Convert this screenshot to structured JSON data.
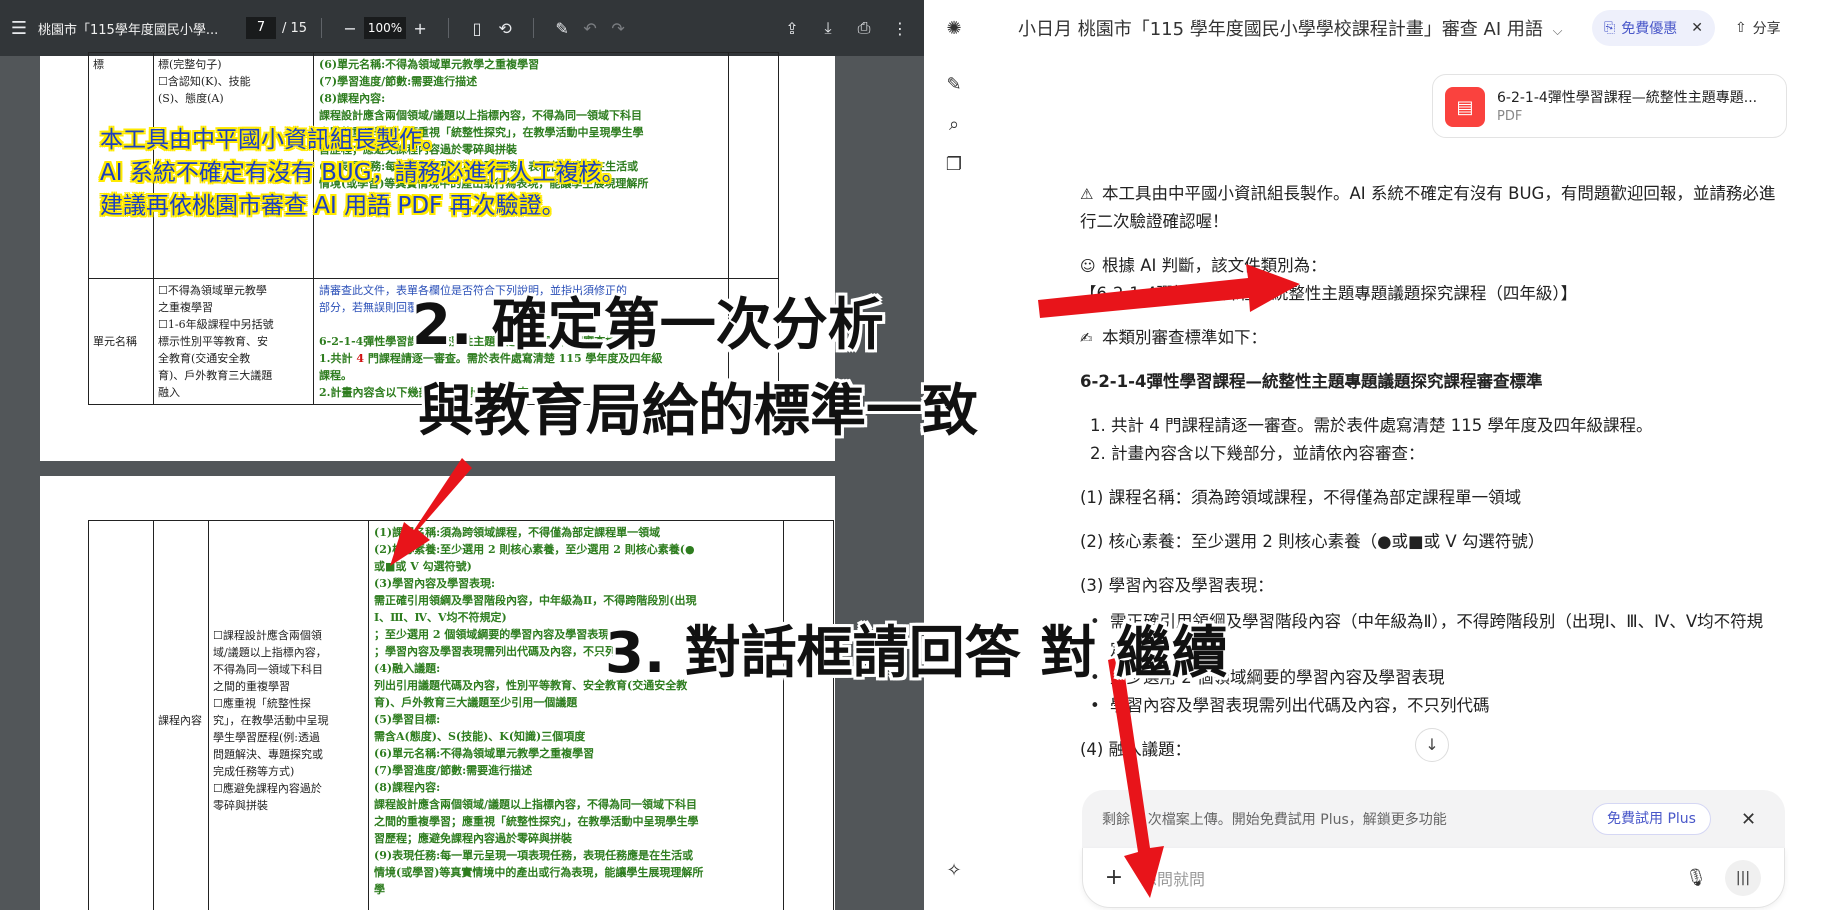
{
  "pdf": {
    "title": "桃園市「115學年度國民小學...",
    "page_current": "7",
    "page_total": "/ 15",
    "zoom": "100%",
    "page_a": {
      "col1": "標",
      "col2_lines": [
        "標(完整句子)",
        "☐含認知(K)、技能",
        "(S)、態度(A)"
      ],
      "col3_lines": [
        {
          "t": "(6)單元名稱:不得為領域單元教學之重複學習",
          "c": "grn"
        },
        {
          "t": "(7)學習進度/節數:需要進行描述",
          "c": "grn"
        },
        {
          "t": "(8)課程內容:",
          "c": "grn"
        },
        {
          "t": "課程設計應含兩個領域/議題以上指標內容，不得為同一領域下科目",
          "c": "grn"
        },
        {
          "t": "之間的重複學習；應重視「統整性探究」，在教學活動中呈現學生學",
          "c": "grn"
        },
        {
          "t": "習歷程；應避免課程內容過於零碎與拼裝",
          "c": "grn"
        },
        {
          "t": "(9)表現任務:每一單元呈現一項表現任務，表現任務應是在生活或",
          "c": "grn"
        },
        {
          "t": "情境(或學習)等真實情境中的產出或行為表現，能讓學生展現理解所",
          "c": "grn"
        }
      ],
      "row2_col1": "單元名稱",
      "row2_col2_lines": [
        "☐不得為領域單元教學",
        "之重複學習",
        "☐1-6年級課程中另括號",
        "標示性別平等教育、安",
        "全教育(交通安全教",
        "育)、戶外教育三大議題",
        "融入"
      ],
      "row2_col3_lines": [
        {
          "t": "請審查此文件，表單各欄位是否符合下列說明，並指出須修正的",
          "c": "blu"
        },
        {
          "t": "部分，若無誤則回覆無誤",
          "c": "blu"
        },
        {
          "t": "",
          "c": ""
        },
        {
          "t": "6-2-1-4彈性學習課程—統整性主題專題議題探究課程審查標準",
          "c": "grn"
        },
        {
          "t": "1.共計 4 門課程請逐一審查。需於表件處寫清楚 115 學年度及四年級",
          "c": "grn",
          "red": "4"
        },
        {
          "t": "課程。",
          "c": "grn"
        },
        {
          "t": "2.計畫內容含以下幾部分，並請依內容審查:",
          "c": "grn"
        }
      ]
    },
    "page_b": {
      "col1": "課程內容",
      "col2_lines": [
        "☐課程設計應含兩個領",
        "域/議題以上指標內容，",
        "不得為同一領域下科目",
        "之間的重複學習",
        "☐應重視「統整性探",
        "究」，在教學活動中呈現",
        "學生學習歷程(例:透過",
        "問題解決、專題探究或",
        "完成任務等方式)",
        "☐應避免課程內容過於",
        "零碎與拼裝"
      ],
      "col3_lines": [
        "(1)課程名稱:須為跨領域課程，不得僅為部定課程單一領域",
        "(2)核心素養:至少選用 2 則核心素養，至少選用 2 則核心素養(●",
        "或■或 V 勾選符號)",
        "(3)學習內容及學習表現:",
        "需正確引用領綱及學習階段內容，中年級為Ⅱ，不得跨階段別(出現",
        "Ⅰ、Ⅲ、Ⅳ、V均不符規定)",
        "；至少選用 2 個領域綱要的學習內容及學習表現",
        "；學習內容及學習表現需列出代碼及內容，不只列代碼",
        "(4)融入議題:",
        "列出引用議題代碼及內容，性別平等教育、安全教育(交通安全教",
        "育)、戶外教育三大議題至少引用一個議題",
        "(5)學習目標:",
        "需含A(態度)、S(技能)、K(知識)三個項度",
        "(6)單元名稱:不得為領域單元教學之重複學習",
        "(7)學習進度/節數:需要進行描述",
        "(8)課程內容:",
        "課程設計應含兩個領域/議題以上指標內容，不得為同一領域下科目",
        "之間的重複學習；應重視「統整性探究」，在教學活動中呈現學生學",
        "習歷程；應避免課程內容過於零碎與拼裝",
        "(9)表現任務:每一單元呈現一項表現任務，表現任務應是在生活或",
        "情境(或學習)等真實情境中的產出或行為表現，能讓學生展現理解所",
        "學"
      ]
    },
    "yellow_note": [
      "本工具由中平國小資訊組長製作。",
      "AI 系統不確定有沒有 BUG，請務必進行人工複核。",
      "建議再依桃園市審查 AI 用語 PDF 再次驗證。"
    ]
  },
  "chat": {
    "title": "小日月 桃園市「115 學年度國民小學學校課程計畫」審查 AI 用語",
    "free_offer": "免費優惠",
    "share": "分享",
    "file": {
      "name": "6-2-1-4彈性學習課程—統整性主題專題...",
      "type": "PDF"
    },
    "messages": {
      "warn": "本工具由中平國小資訊組長製作。AI 系統不確定有沒有 BUG，有問題歡迎回報，並請務必進行二次驗證確認喔！",
      "judge": "根據 AI 判斷，該文件類別為：",
      "category": "【6-2-1-4彈性學習課程—統整性主題專題議題探究課程（四年級）】",
      "criteria_intro": "本類別審查標準如下：",
      "heading": "6-2-1-4彈性學習課程—統整性主題專題議題探究課程審查標準",
      "item1": "1.  共計 4 門課程請逐一審查。需於表件處寫清楚 115 學年度及四年級課程。",
      "item2": "2.  計畫內容含以下幾部分，並請依內容審查：",
      "p1": "(1) 課程名稱：須為跨領域課程，不得僅為部定課程單一領域",
      "p2": "(2) 核心素養：至少選用 2 則核心素養（●或■或 V 勾選符號）",
      "p3": "(3) 學習內容及學習表現：",
      "b1": "需正確引用領綱及學習階段內容（中年級為Ⅱ），不得跨階段別（出現Ⅰ、Ⅲ、Ⅳ、V均不符規定）",
      "b2": "至少選用 2 個領域綱要的學習內容及學習表現",
      "b3": "學習內容及學習表現需列出代碼及內容，不只列代碼",
      "p4": "(4) 融入議題："
    },
    "upsell_text": "剩餘 0 次檔案上傳。開始免費試用 Plus，解鎖更多功能",
    "upsell_button": "免費試用 Plus",
    "composer_placeholder": "想問就問"
  },
  "overlay": {
    "caption_line1": "2. 確定第一次分析",
    "caption_line2": "與教育局給的標準一致",
    "caption_line3": "3. 對話框請回答 對 繼續",
    "arrow_color": "#e8141a"
  }
}
